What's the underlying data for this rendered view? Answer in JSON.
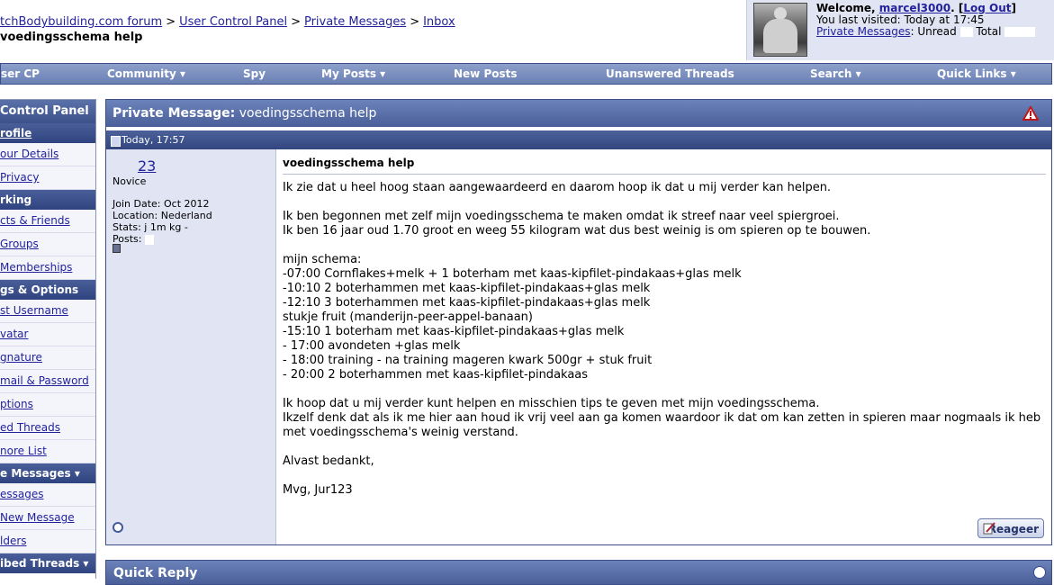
{
  "breadcrumb": {
    "items": [
      "tchBodybuilding.com forum",
      "User Control Panel",
      "Private Messages",
      "Inbox"
    ],
    "sep": ">"
  },
  "page_title": "voedingsschema help",
  "welcome": {
    "prefix": "Welcome, ",
    "username": "marcel3000",
    "logout": "Log Out",
    "last_visited_label": "You last visited: Today at ",
    "last_visited_time": "17:45",
    "pm_label": "Private Messages",
    "unread_label": ": Unread ",
    "total_label": " Total "
  },
  "navbar": {
    "items": [
      {
        "label": "ser CP"
      },
      {
        "label": "Community ▾"
      },
      {
        "label": "Spy"
      },
      {
        "label": "My Posts ▾"
      },
      {
        "label": "New Posts"
      },
      {
        "label": "Unanswered Threads"
      },
      {
        "label": "Search ▾"
      },
      {
        "label": "Quick Links ▾"
      }
    ]
  },
  "sidebar": {
    "title": " Control Panel",
    "sections": [
      {
        "type": "sub",
        "label": "rofile"
      },
      {
        "type": "item",
        "label": "our Details"
      },
      {
        "type": "item",
        "label": " Privacy"
      },
      {
        "type": "sub",
        "label": "rking"
      },
      {
        "type": "item",
        "label": "cts & Friends"
      },
      {
        "type": "item",
        "label": " Groups"
      },
      {
        "type": "item",
        "label": " Memberships"
      },
      {
        "type": "sub",
        "label": "gs & Options"
      },
      {
        "type": "item",
        "label": "st Username"
      },
      {
        "type": "item",
        "label": "vatar"
      },
      {
        "type": "item",
        "label": "gnature"
      },
      {
        "type": "item",
        "label": "mail & Password"
      },
      {
        "type": "item",
        "label": "ptions"
      },
      {
        "type": "item",
        "label": "ed Threads"
      },
      {
        "type": "item",
        "label": "nore List"
      },
      {
        "type": "sub",
        "label": "e Messages ▾"
      },
      {
        "type": "item",
        "label": "essages"
      },
      {
        "type": "item",
        "label": "New Message"
      },
      {
        "type": "item",
        "label": "lders"
      },
      {
        "type": "sub",
        "label": "ibed Threads ▾"
      }
    ]
  },
  "pm": {
    "header_label": "Private Message:",
    "header_subject": " voedingsschema help",
    "date": "Today, 17:57",
    "user": {
      "name": "23",
      "title": "Novice",
      "join_date": "Join Date: Oct 2012",
      "location": "Location: Nederland",
      "stats": "Stats:     j 1m     kg -",
      "posts": "Posts: "
    },
    "subject": "voedingsschema help",
    "body": "Ik zie dat u heel hoog staan aangewaardeerd en daarom hoop ik dat u mij verder kan helpen.\n\nIk ben begonnen met zelf mijn voedingsschema te maken omdat ik streef naar veel spiergroei.\nIk ben 16 jaar oud 1.70 groot en weeg 55 kilogram wat dus best weinig is om spieren op te bouwen.\n\nmijn schema:\n-07:00 Cornflakes+melk + 1 boterham met kaas-kipfilet-pindakaas+glas melk\n-10:10 2 boterhammen met kaas-kipfilet-pindakaas+glas melk\n-12:10 3 boterhammen met kaas-kipfilet-pindakaas+glas melk\nstukje fruit (manderijn-peer-appel-banaan)\n-15:10 1 boterham met kaas-kipfilet-pindakaas+glas melk\n- 17:00 avondeten +glas melk\n- 18:00 training - na training mageren kwark 500gr + stuk fruit\n- 20:00 2 boterhammen met kaas-kipfilet-pindakaas\n\nIk hoop dat u mij verder kunt helpen en misschien tips te geven met mijn voedingsschema.\nIkzelf denk dat als ik me hier aan houd ik vrij veel aan ga komen waardoor ik dat om kan zetten in spieren maar nogmaals ik heb\nmet voedingsschema's weinig verstand.\n\nAlvast bedankt,\n\nMvg, Jur123",
    "reply_label": "Reageer"
  },
  "quick_reply": {
    "label": "Quick Reply"
  }
}
